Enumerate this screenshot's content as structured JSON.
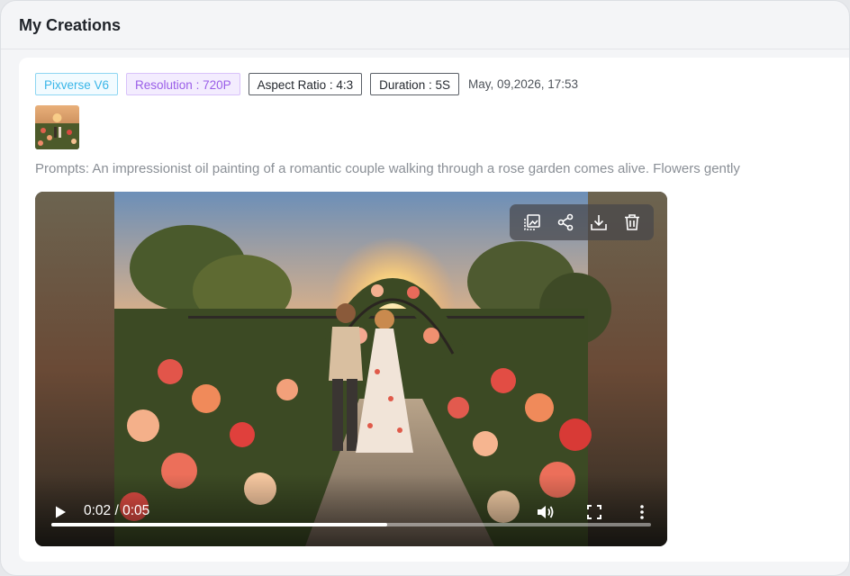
{
  "panel": {
    "title": "My Creations"
  },
  "creation": {
    "tags": {
      "model": "Pixverse V6",
      "resolution": "Resolution : 720P",
      "aspect_ratio": "Aspect Ratio : 4:3",
      "duration": "Duration : 5S"
    },
    "date": "May, 09,2026, 17:53",
    "prompt": "Prompts: An impressionist oil painting of a romantic couple walking through a rose garden comes alive. Flowers gently"
  },
  "video": {
    "time": "0:02 / 0:05",
    "progress_fraction": 0.56,
    "toolbar_icons": [
      "image-select-icon",
      "share-icon",
      "download-icon",
      "trash-icon"
    ],
    "control_icons": [
      "play-icon",
      "volume-icon",
      "fullscreen-icon",
      "more-vertical-icon"
    ]
  },
  "colors": {
    "model_tag": "#3ab6e8",
    "resolution_tag": "#9a5ee8",
    "prompt_text": "#8a8f96",
    "toolbar_bg": "#46464b"
  }
}
